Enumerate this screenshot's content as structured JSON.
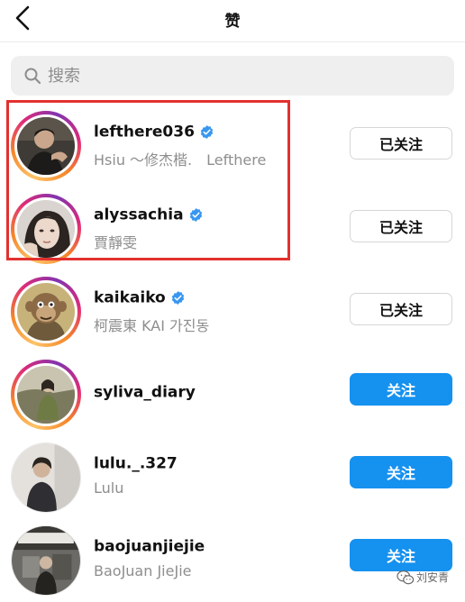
{
  "header": {
    "title": "赞"
  },
  "search": {
    "placeholder": "搜索",
    "value": ""
  },
  "users": [
    {
      "username": "lefthere036",
      "verified": true,
      "full_name": "Hsiu 〜修杰楷.　Lefthere",
      "button": "已关注",
      "following": true,
      "story_ring": true
    },
    {
      "username": "alyssachia",
      "verified": true,
      "full_name": "賈靜雯",
      "button": "已关注",
      "following": true,
      "story_ring": true
    },
    {
      "username": "kaikaiko",
      "verified": true,
      "full_name": "柯震東 KAI 가진동",
      "button": "已关注",
      "following": true,
      "story_ring": true
    },
    {
      "username": "syliva_diary",
      "verified": false,
      "full_name": "",
      "button": "关注",
      "following": false,
      "story_ring": true
    },
    {
      "username": "lulu._.327",
      "verified": false,
      "full_name": "Lulu",
      "button": "关注",
      "following": false,
      "story_ring": false
    },
    {
      "username": "baojuanjiejie",
      "verified": false,
      "full_name": "BaoJuan JieJie",
      "button": "关注",
      "following": false,
      "story_ring": false
    }
  ],
  "watermark": {
    "text": "刘安青"
  },
  "colors": {
    "follow_button": "#1591ef",
    "verified_badge": "#3897f0",
    "highlight_box": "#e3312f",
    "secondary_text": "#8e8e8e"
  },
  "icons": {
    "back": "chevron-left-icon",
    "search": "search-icon",
    "verified": "verified-badge-icon",
    "watermark": "wechat-icon"
  }
}
